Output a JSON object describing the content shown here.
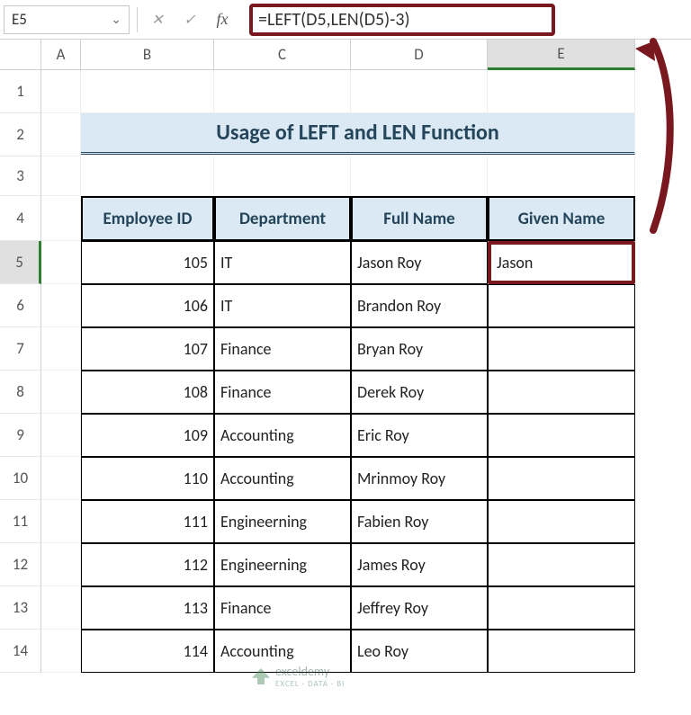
{
  "nameBox": "E5",
  "formula": "=LEFT(D5,LEN(D5)-3)",
  "columns": [
    "A",
    "B",
    "C",
    "D",
    "E"
  ],
  "selectedColumn": "E",
  "rowNumbers": [
    "1",
    "2",
    "3",
    "4",
    "5",
    "6",
    "7",
    "8",
    "9",
    "10",
    "11",
    "12",
    "13",
    "14"
  ],
  "selectedRow": "5",
  "title": "Usage of LEFT and LEN Function",
  "tableHeaders": {
    "b": "Employee ID",
    "c": "Department",
    "d": "Full Name",
    "e": "Given Name"
  },
  "tableRows": [
    {
      "id": "105",
      "dept": "IT",
      "full": "Jason Roy",
      "given": "Jason"
    },
    {
      "id": "106",
      "dept": "IT",
      "full": "Brandon Roy",
      "given": ""
    },
    {
      "id": "107",
      "dept": "Finance",
      "full": "Bryan Roy",
      "given": ""
    },
    {
      "id": "108",
      "dept": "Finance",
      "full": "Derek Roy",
      "given": ""
    },
    {
      "id": "109",
      "dept": "Accounting",
      "full": "Eric Roy",
      "given": ""
    },
    {
      "id": "110",
      "dept": "Accounting",
      "full": "Mrinmoy Roy",
      "given": ""
    },
    {
      "id": "111",
      "dept": "Engineerning",
      "full": "Fabien Roy",
      "given": ""
    },
    {
      "id": "112",
      "dept": "Engineerning",
      "full": "James Roy",
      "given": ""
    },
    {
      "id": "113",
      "dept": "Finance",
      "full": "Jeffrey Roy",
      "given": ""
    },
    {
      "id": "114",
      "dept": "Accounting",
      "full": "Leo Roy",
      "given": ""
    }
  ],
  "watermark": {
    "brand": "exceldemy",
    "tagline": "EXCEL · DATA · BI"
  }
}
